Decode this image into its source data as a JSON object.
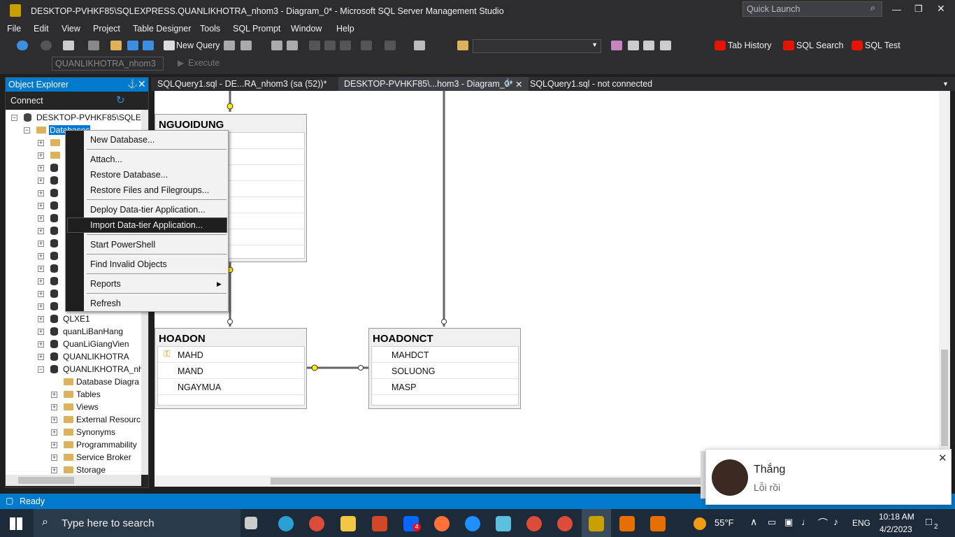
{
  "window": {
    "title": "DESKTOP-PVHKF85\\SQLEXPRESS.QUANLIKHOTRA_nhom3 - Diagram_0* - Microsoft SQL Server Management Studio",
    "quick_launch_placeholder": "Quick Launch"
  },
  "menu": [
    "File",
    "Edit",
    "View",
    "Project",
    "Table Designer",
    "Tools",
    "SQL Prompt",
    "Window",
    "Help"
  ],
  "toolbar": {
    "new_query": "New Query",
    "tab_history": "Tab History",
    "sql_search": "SQL Search",
    "sql_test": "SQL Test",
    "database_select": "QUANLIKHOTRA_nhom3",
    "execute": "Execute"
  },
  "object_explorer": {
    "title": "Object Explorer",
    "connect": "Connect",
    "server": "DESKTOP-PVHKF85\\SQLEX",
    "databases": "Databases",
    "db_items": [
      "QLXE1",
      "quanLiBanHang",
      "QuanLiGiangVien",
      "QUANLIKHOTRA",
      "QUANLIKHOTRA_nh"
    ],
    "sub_items": [
      "Database Diagra",
      "Tables",
      "Views",
      "External Resourc",
      "Synonyms",
      "Programmability",
      "Service Broker",
      "Storage"
    ]
  },
  "tabs": [
    "SQLQuery1.sql - DE...RA_nhom3 (sa (52))*",
    "DESKTOP-PVHKF85\\...hom3 - Diagram_0*",
    "SQLQuery1.sql - not connected"
  ],
  "context_menu": {
    "items": [
      "New Database...",
      "Attach...",
      "Restore Database...",
      "Restore Files and Filegroups...",
      "Deploy Data-tier Application...",
      "Import Data-tier Application...",
      "Start PowerShell",
      "Find Invalid Objects",
      "Reports",
      "Refresh"
    ],
    "highlighted": "Import Data-tier Application..."
  },
  "diagram": {
    "tables": [
      {
        "name": "NGUOIDUNG",
        "columns": []
      },
      {
        "name": "HOADON",
        "columns": [
          "MAHD",
          "MAND",
          "NGAYMUA"
        ]
      },
      {
        "name": "HOADONCT",
        "columns": [
          "MAHDCT",
          "SOLUONG",
          "MASP"
        ]
      }
    ]
  },
  "status": {
    "text": "Ready"
  },
  "notification": {
    "sender": "Thắng",
    "message": "Lỗi rồi"
  },
  "taskbar": {
    "search_placeholder": "Type here to search",
    "weather": "55°F",
    "lang": "ENG",
    "time": "10:18 AM",
    "date": "4/2/2023",
    "badge_count": "4",
    "notif_count": "2"
  }
}
